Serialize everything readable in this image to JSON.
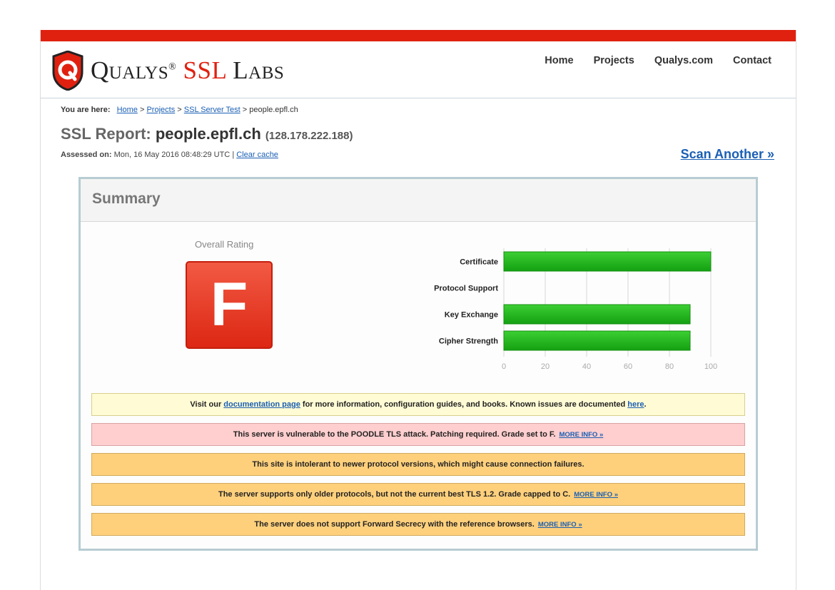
{
  "colors": {
    "brand_red": "#e02110",
    "link": "#1a5fb4",
    "bar_green": "#22b51f"
  },
  "brand": {
    "name_q": "Qualys",
    "reg": "®",
    "name_ssl": "SSL",
    "name_labs": "Labs",
    "icon": "qualys-shield-icon"
  },
  "nav": [
    "Home",
    "Projects",
    "Qualys.com",
    "Contact"
  ],
  "breadcrumb": {
    "prefix": "You are here:",
    "items": [
      "Home",
      "Projects",
      "SSL Server Test"
    ],
    "separator": ">",
    "current": "people.epfl.ch"
  },
  "report": {
    "title_prefix": "SSL Report:",
    "host": "people.epfl.ch",
    "ip": "(128.178.222.188)",
    "assessed_label": "Assessed on:",
    "assessed_value": "Mon, 16 May 2016 08:48:29 UTC",
    "divider": "|",
    "clear_cache": "Clear cache",
    "scan_another": "Scan Another »"
  },
  "summary": {
    "heading": "Summary",
    "rating_label": "Overall Rating",
    "grade": "F"
  },
  "chart_data": {
    "type": "bar",
    "orientation": "horizontal",
    "categories": [
      "Certificate",
      "Protocol Support",
      "Key Exchange",
      "Cipher Strength"
    ],
    "values": [
      100,
      0,
      90,
      90
    ],
    "xlim": [
      0,
      100
    ],
    "xticks": [
      0,
      20,
      40,
      60,
      80,
      100
    ],
    "grid": true
  },
  "notices": [
    {
      "style": "yellow",
      "pre": "Visit our",
      "link1": "documentation page",
      "mid": "for more information, configuration guides, and books. Known issues are documented",
      "link2": "here",
      "post": "."
    },
    {
      "style": "red",
      "text": "This server is vulnerable to the POODLE TLS attack. Patching required. Grade set to F.",
      "more": "MORE INFO »"
    },
    {
      "style": "orange",
      "text": "This site is intolerant to newer protocol versions, which might cause connection failures."
    },
    {
      "style": "orange",
      "text": "The server supports only older protocols, but not the current best TLS 1.2. Grade capped to C.",
      "more": "MORE INFO »"
    },
    {
      "style": "orange",
      "text": "The server does not support Forward Secrecy with the reference browsers.",
      "more": "MORE INFO »"
    }
  ]
}
